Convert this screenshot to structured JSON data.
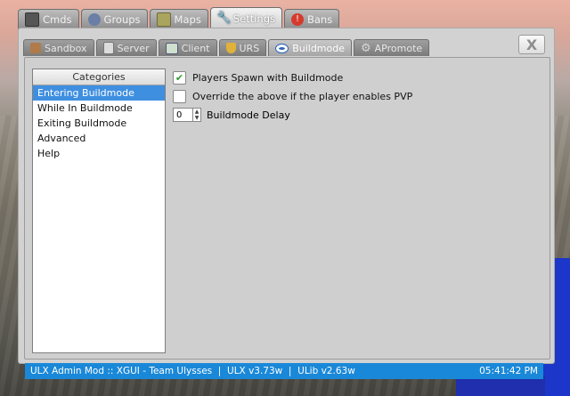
{
  "top_tabs": [
    {
      "label": "Cmds",
      "icon": "terminal-icon",
      "color": "#555555"
    },
    {
      "label": "Groups",
      "icon": "group-icon",
      "color": "#6b7fa6"
    },
    {
      "label": "Maps",
      "icon": "map-icon",
      "color": "#9c9b5a"
    },
    {
      "label": "Settings",
      "icon": "wrench-icon",
      "color": "#4b7fc8",
      "active": true
    },
    {
      "label": "Bans",
      "icon": "ban-icon",
      "color": "#d63a2d"
    }
  ],
  "sub_tabs": [
    {
      "label": "Sandbox",
      "icon": "sandbox-icon"
    },
    {
      "label": "Server",
      "icon": "server-icon"
    },
    {
      "label": "Client",
      "icon": "client-icon"
    },
    {
      "label": "URS",
      "icon": "shield-icon"
    },
    {
      "label": "Buildmode",
      "icon": "eye-icon",
      "active": true
    },
    {
      "label": "APromote",
      "icon": "gear-icon"
    }
  ],
  "close_label": "X",
  "categories": {
    "header": "Categories",
    "items": [
      "Entering Buildmode",
      "While In Buildmode",
      "Exiting Buildmode",
      "Advanced",
      "Help"
    ],
    "selected_index": 0
  },
  "settings": {
    "spawn_with_buildmode": {
      "label": "Players Spawn with Buildmode",
      "checked": true
    },
    "override_pvp": {
      "label": "Override the above if the player enables PVP",
      "checked": false
    },
    "delay": {
      "label": "Buildmode Delay",
      "value": "0"
    }
  },
  "status_bar": {
    "left": "ULX Admin Mod :: XGUI - Team Ulysses  |  ULX v3.73w  |  ULib v2.63w",
    "time": "05:41:42 PM"
  },
  "colors": {
    "accent": "#3f8fe0",
    "status_bg": "#1a88d8",
    "check": "#2e9a2e"
  }
}
